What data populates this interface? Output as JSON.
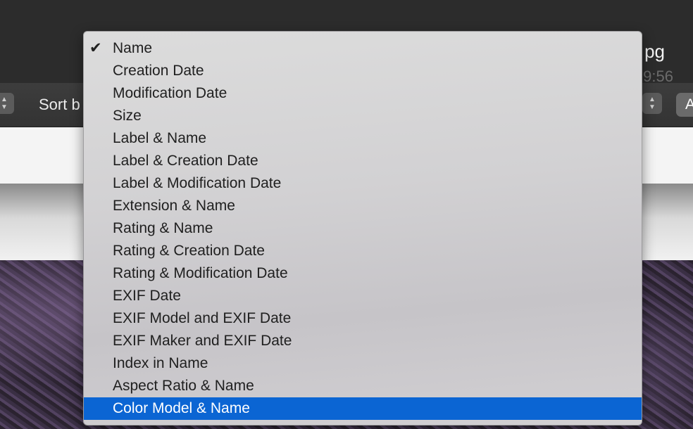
{
  "window": {
    "title_fragment": "pg",
    "subtitle_fragment": "9:56"
  },
  "toolbar": {
    "sort_label": "Sort b",
    "right_button_label": "A"
  },
  "sort_menu": {
    "checked_item": "Name",
    "highlighted_item": "Color Model & Name",
    "items": [
      {
        "label": "Name"
      },
      {
        "label": "Creation Date"
      },
      {
        "label": "Modification Date"
      },
      {
        "label": "Size"
      },
      {
        "label": "Label & Name"
      },
      {
        "label": "Label & Creation Date"
      },
      {
        "label": "Label & Modification Date"
      },
      {
        "label": "Extension & Name"
      },
      {
        "label": "Rating & Name"
      },
      {
        "label": "Rating & Creation Date"
      },
      {
        "label": "Rating & Modification Date"
      },
      {
        "label": "EXIF Date"
      },
      {
        "label": "EXIF Model and EXIF Date"
      },
      {
        "label": "EXIF Maker and EXIF Date"
      },
      {
        "label": "Index in Name"
      },
      {
        "label": "Aspect Ratio & Name"
      },
      {
        "label": "Color Model & Name"
      }
    ]
  },
  "colors": {
    "highlight": "#0b65d3",
    "menu_background": "#d2d1d3",
    "titlebar": "#2c2c2c"
  }
}
